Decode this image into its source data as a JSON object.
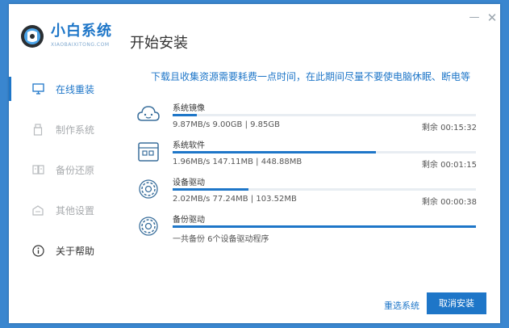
{
  "app": {
    "name": "小白系统",
    "subtitle": "XIAOBAIXITONG.COM"
  },
  "page_title": "开始安装",
  "window_controls": {
    "minimize_icon": "minimize-icon",
    "close_icon": "close-icon"
  },
  "sidebar": {
    "items": [
      {
        "label": "在线重装",
        "icon": "monitor-icon",
        "state": "active"
      },
      {
        "label": "制作系统",
        "icon": "usb-drive-icon",
        "state": "disabled"
      },
      {
        "label": "备份还原",
        "icon": "backup-restore-icon",
        "state": "disabled"
      },
      {
        "label": "其他设置",
        "icon": "settings-box-icon",
        "state": "disabled"
      },
      {
        "label": "关于帮助",
        "icon": "info-icon",
        "state": "normal"
      }
    ]
  },
  "notice": "下载且收集资源需要耗费一点时间，在此期间尽量不要使电脑休眠、断电等",
  "tasks": [
    {
      "name": "系统镜像",
      "icon": "cloud-face-icon",
      "progress": 0.08,
      "info": "9.87MB/s 9.00GB | 9.85GB",
      "remaining": "剩余 00:15:32"
    },
    {
      "name": "系统软件",
      "icon": "apps-grid-icon",
      "progress": 0.67,
      "info": "1.96MB/s 147.11MB | 448.88MB",
      "remaining": "剩余 00:01:15"
    },
    {
      "name": "设备驱动",
      "icon": "gear-icon",
      "progress": 0.25,
      "info": "2.02MB/s 77.24MB | 103.52MB",
      "remaining": "剩余 00:00:38"
    },
    {
      "name": "备份驱动",
      "icon": "gear-icon",
      "progress": 1.0,
      "info": "一共备份 6个设备驱动程序",
      "remaining": ""
    }
  ],
  "footer": {
    "reselect_label": "重选系统",
    "cancel_label": "取消安装"
  },
  "colors": {
    "accent": "#1e76c8",
    "track": "#e8edf2",
    "background": "#3a86cf"
  }
}
